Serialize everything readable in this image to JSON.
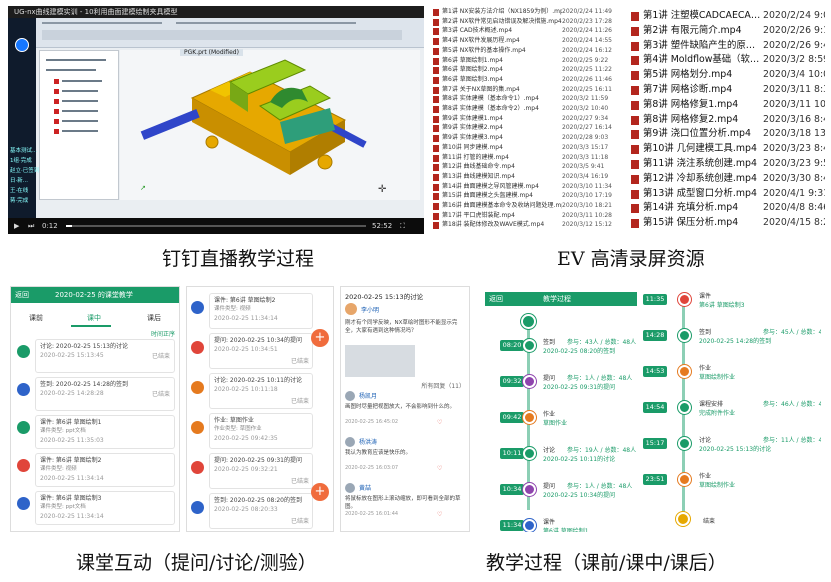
{
  "captions": {
    "live": "钉钉直播教学过程",
    "ev": "EV 高清录屏资源",
    "interact": "课堂互动（提问/讨论/测验）",
    "process": "教学过程（课前/课中/课后）"
  },
  "video": {
    "window_title": "UG-nx曲线建模实训 - 10利用曲面建模绘制夹具模型",
    "time_current": "0:12",
    "time_total": "52:52",
    "viewport_tab": "PGK.prt (Modified)",
    "chat_lines": [
      "基本测试...",
      "1组·完成",
      "赵立·已签到",
      "日·新...",
      "王·在线",
      "蒋·完成"
    ]
  },
  "files_left": [
    {
      "name": "第1讲 NX安装方法介绍（NX1859为例）.mp4",
      "date": "2020/2/24 11:49"
    },
    {
      "name": "第2讲 NX软件常见启动错误及解决措施.mp4",
      "date": "2020/2/23 17:28"
    },
    {
      "name": "第3讲 CAD技术概述.mp4",
      "date": "2020/2/24 11:26"
    },
    {
      "name": "第4讲 NX软件发展历程.mp4",
      "date": "2020/2/24 14:55"
    },
    {
      "name": "第5讲 NX软件的基本操作.mp4",
      "date": "2020/2/24 16:12"
    },
    {
      "name": "第6讲 草图绘制1.mp4",
      "date": "2020/2/25 9:22"
    },
    {
      "name": "第6讲 草图绘制2.mp4",
      "date": "2020/2/25 11:22"
    },
    {
      "name": "第6讲 草图绘制3.mp4",
      "date": "2020/2/26 11:46"
    },
    {
      "name": "第7讲 关于NX草图的集.mp4",
      "date": "2020/2/25 16:11"
    },
    {
      "name": "第8讲 实体建模（基本命令1）.mp4",
      "date": "2020/3/2 11:59"
    },
    {
      "name": "第8讲 实体建模（基本命令2）.mp4",
      "date": "2020/3/2 10:40"
    },
    {
      "name": "第9讲 实体建模1.mp4",
      "date": "2020/2/27 9:34"
    },
    {
      "name": "第9讲 实体建模2.mp4",
      "date": "2020/2/27 16:14"
    },
    {
      "name": "第9讲 实体建模3.mp4",
      "date": "2020/2/28 9:03"
    },
    {
      "name": "第10讲 同步建模.mp4",
      "date": "2020/3/3 15:17"
    },
    {
      "name": "第11讲 打管的建模.mp4",
      "date": "2020/3/3 11:18"
    },
    {
      "name": "第12讲 曲线基础命令.mp4",
      "date": "2020/3/5 9:41"
    },
    {
      "name": "第13讲 曲线建模知识.mp4",
      "date": "2020/3/4 16:19"
    },
    {
      "name": "第14讲 曲面建模之导风管建模.mp4",
      "date": "2020/3/10 11:34"
    },
    {
      "name": "第15讲 曲面建模之头盔建模.mp4",
      "date": "2020/3/10 17:19"
    },
    {
      "name": "第16讲 曲面建模基本命令及收纳问题处理.mp4",
      "date": "2020/3/10 18:21"
    },
    {
      "name": "第17讲 平口虎钳装配.mp4",
      "date": "2020/3/11 10:28"
    },
    {
      "name": "第18讲 装配体修改及WAVE模式.mp4",
      "date": "2020/3/12 15:12"
    }
  ],
  "files_right": [
    {
      "name": "第1讲 注塑模CADCAECA…",
      "date": "2020/2/24 9:07"
    },
    {
      "name": "第2讲 有限元简介.mp4",
      "date": "2020/2/26 9:17"
    },
    {
      "name": "第3讲 塑件缺陷产生的原…",
      "date": "2020/2/26 9:44"
    },
    {
      "name": "第4讲 Moldflow基础（软…",
      "date": "2020/3/2 8:59"
    },
    {
      "name": "第5讲 网格划分.mp4",
      "date": "2020/3/4 10:02"
    },
    {
      "name": "第7讲 网格诊断.mp4",
      "date": "2020/3/11 8:39"
    },
    {
      "name": "第8讲 网格修复1.mp4",
      "date": "2020/3/11 10:36"
    },
    {
      "name": "第8讲 网格修复2.mp4",
      "date": "2020/3/16 8:48"
    },
    {
      "name": "第9讲 浇口位置分析.mp4",
      "date": "2020/3/18 13:33"
    },
    {
      "name": "第10讲 几何建模工具.mp4",
      "date": "2020/3/23 8:45"
    },
    {
      "name": "第11讲 浇注系统创建.mp4",
      "date": "2020/3/23 9:51"
    },
    {
      "name": "第12讲 冷却系统创建.mp4",
      "date": "2020/3/30 8:42"
    },
    {
      "name": "第13讲 成型窗口分析.mp4",
      "date": "2020/4/1 9:31"
    },
    {
      "name": "第14讲 充填分析.mp4",
      "date": "2020/4/8 8:46"
    },
    {
      "name": "第15讲 保压分析.mp4",
      "date": "2020/4/15 8:24"
    }
  ],
  "classroom": {
    "phone1": {
      "back": "返回",
      "title": "2020-02-25 的课堂教学",
      "tabs": [
        "课前",
        "课中",
        "课后"
      ],
      "sort": "时间正序",
      "items": [
        {
          "title": "讨论: 2020-02-25 15:13的讨论",
          "time": "2020-02-25 15:13:45",
          "state": "已结束"
        },
        {
          "title": "签到: 2020-02-25 14:28的签到",
          "time": "2020-02-25 14:28:28",
          "state": "已结束"
        },
        {
          "title": "课件: 第6讲 草图绘制1",
          "sub": "课件类型: ppt文档",
          "time": "2020-02-25 11:35:03",
          "state": ""
        },
        {
          "title": "课件: 第6讲 草图绘制2",
          "sub": "课件类型: 视频",
          "time": "2020-02-25 11:34:14",
          "state": ""
        },
        {
          "title": "课件: 第6讲 草图绘制3",
          "sub": "课件类型: ppt文档",
          "time": "2020-02-25 11:34:14",
          "state": ""
        }
      ]
    },
    "phone2": {
      "items": [
        {
          "title": "课件: 第6讲 草图绘制2",
          "sub": "课件类型: 视频",
          "time": "2020-02-25 11:34:14",
          "state": ""
        },
        {
          "title": "提问: 2020-02-25 10:34的提问",
          "time": "2020-02-25 10:34:51",
          "state": "已结束"
        },
        {
          "title": "讨论: 2020-02-25 10:11的讨论",
          "time": "2020-02-25 10:11:18",
          "state": "已结束"
        },
        {
          "title": "作业: 草图作业",
          "sub": "作业类型: 草图作业",
          "time": "2020-02-25 09:42:35",
          "state": ""
        },
        {
          "title": "提问: 2020-02-25 09:31的提问",
          "time": "2020-02-25 09:32:21",
          "state": "已结束"
        },
        {
          "title": "签到: 2020-02-25 08:20的签到",
          "time": "2020-02-25 08:20:33",
          "state": "已结束"
        }
      ]
    },
    "phone3": {
      "title": "2020-02-25 15:13的讨论",
      "author": "李小明",
      "post": "刚才有个同学反映，NX草绘时图形不能显示完全，大家有遇到这种情况吗？",
      "reply_header": "所有回复（11）",
      "replies": [
        {
          "name": "杨凯月",
          "text": "画图时尽量把视图放大，不会影响到什么的。",
          "time": "2020-02-25 16:45:02"
        },
        {
          "name": "杨洪涛",
          "text": "我认为教育应该是快乐的。",
          "time": "2020-02-25 16:03:07"
        },
        {
          "name": "黄喆",
          "text": "将鼠标放在图形上滚动缩放，即可看到全部的草图。",
          "time": "2020-02-25 16:01:44"
        }
      ]
    }
  },
  "process": {
    "back": "返回",
    "title": "教学过程",
    "entries": [
      {
        "time": "08:20",
        "type": "签到",
        "name": "2020-02-25 08:20的签到",
        "stats": "参与：43人 / 总数：48人",
        "color": "#1a9b68"
      },
      {
        "time": "09:32",
        "type": "提问",
        "name": "2020-02-25 09:31的提问",
        "stats": "参与：1人 / 总数：48人",
        "color": "#8e44ad"
      },
      {
        "time": "09:42",
        "type": "作业",
        "name": "草图作业",
        "stats": "",
        "color": "#e57a1f"
      },
      {
        "time": "10:11",
        "type": "讨论",
        "name": "2020-02-25 10:11的讨论",
        "stats": "参与：19人 / 总数：48人",
        "color": "#1a9b68"
      },
      {
        "time": "10:34",
        "type": "提问",
        "name": "2020-02-25 10:34的提问",
        "stats": "参与：1人 / 总数：48人",
        "color": "#8e44ad"
      },
      {
        "time": "11:34",
        "type": "课件",
        "name": "第6讲 草图绘制1",
        "stats": "",
        "color": "#2e63c9"
      }
    ],
    "right_entries": [
      {
        "time": "11:35",
        "type": "课件",
        "name": "第6讲 草图绘制3",
        "stats": "",
        "color": "#e0453a"
      },
      {
        "time": "14:28",
        "type": "签到",
        "name": "2020-02-25 14:28的签到",
        "stats": "参与：45人 / 总数：48人",
        "color": "#1a9b68"
      },
      {
        "time": "14:53",
        "type": "作业",
        "name": "草图绘制作业",
        "stats": "",
        "color": "#e57a1f"
      },
      {
        "time": "14:54",
        "type": "课程安排",
        "name": "完成附件作业",
        "stats": "参与：46人 / 总数：48人",
        "color": "#1a9b68"
      },
      {
        "time": "15:17",
        "type": "讨论",
        "name": "2020-02-25 15:13的讨论",
        "stats": "参与：11人 / 总数：48人",
        "color": "#1a9b68"
      },
      {
        "time": "23:51",
        "type": "作业",
        "name": "草图绘制作业",
        "stats": "",
        "color": "#e57a1f"
      }
    ],
    "end": "结束"
  }
}
